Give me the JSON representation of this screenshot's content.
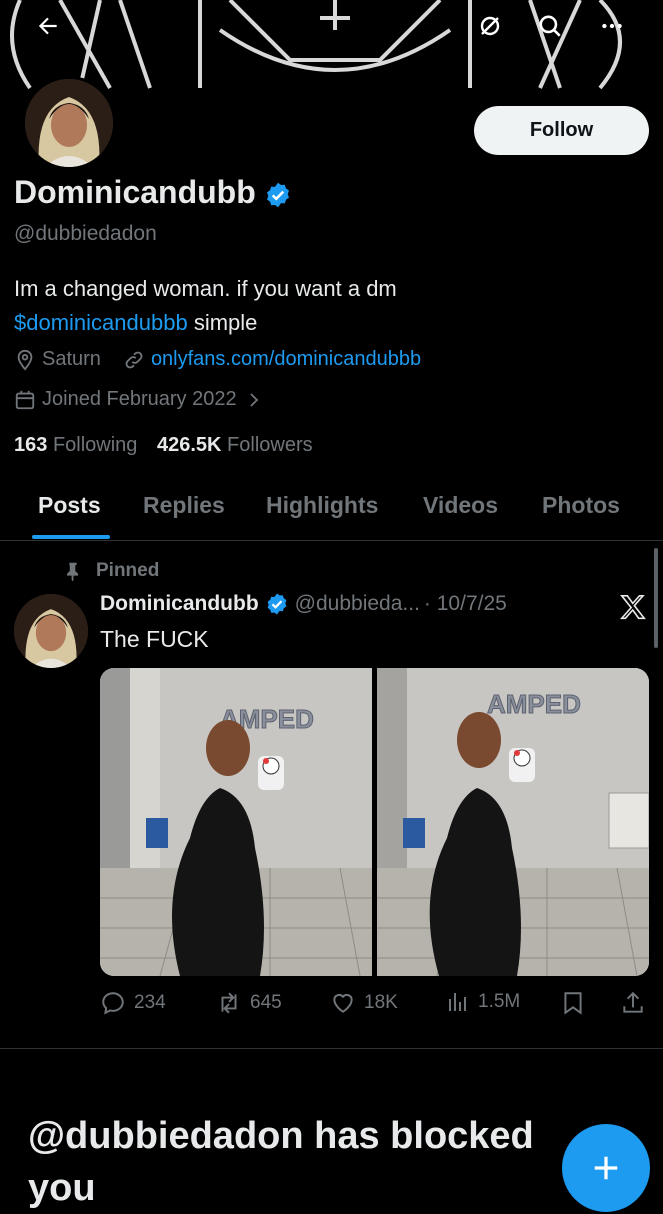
{
  "profile": {
    "name": "Dominicandubb",
    "handle": "@dubbiedadon",
    "bio_line1": "Im a changed woman. if you want a dm",
    "bio_link": "$dominicandubbb",
    "bio_line2_rest": " simple",
    "location": "Saturn",
    "website": "onlyfans.com/dominicandubbb",
    "joined": "Joined February 2022",
    "following_count": "163",
    "following_label": "Following",
    "followers_count": "426.5K",
    "followers_label": "Followers"
  },
  "header": {
    "follow_label": "Follow",
    "icons": [
      "back-arrow-icon",
      "grok-icon",
      "search-icon",
      "more-icon"
    ]
  },
  "tabs": [
    {
      "label": "Posts",
      "active": true
    },
    {
      "label": "Replies",
      "active": false
    },
    {
      "label": "Highlights",
      "active": false
    },
    {
      "label": "Videos",
      "active": false
    },
    {
      "label": "Photos",
      "active": false
    }
  ],
  "post": {
    "pinned_label": "Pinned",
    "author": "Dominicandubb",
    "handle": "@dubbieda...",
    "date": "· 10/7/25",
    "text": "The FUCK",
    "replies": "234",
    "reposts": "645",
    "likes": "18K",
    "views": "1.5M"
  },
  "blocked_notice": "@dubbiedadon has blocked you",
  "colors": {
    "accent": "#1d9bf0",
    "background": "#000000",
    "text": "#e7e9ea",
    "muted": "#71767b"
  }
}
